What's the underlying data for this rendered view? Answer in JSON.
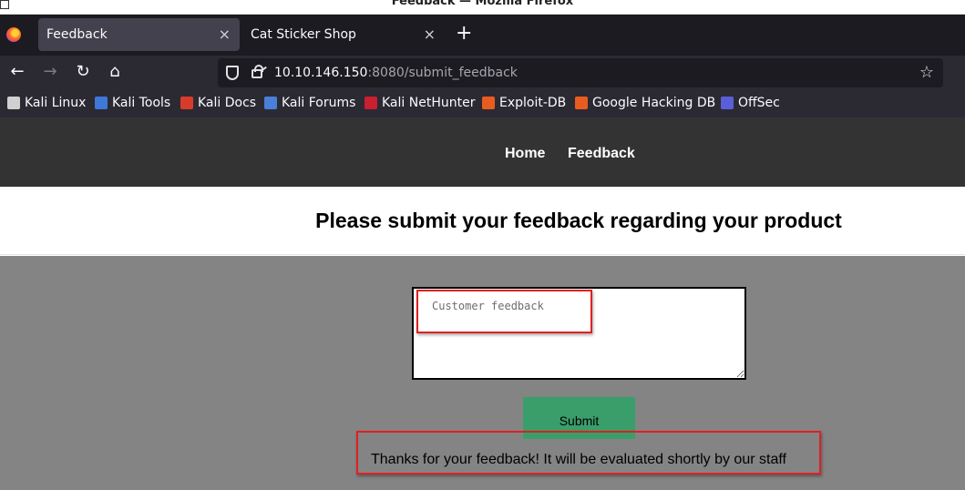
{
  "window": {
    "title": "Feedback — Mozilla Firefox"
  },
  "tabs": [
    {
      "label": "Feedback",
      "close": "×"
    },
    {
      "label": "Cat Sticker Shop",
      "close": "×"
    }
  ],
  "new_tab": "+",
  "nav": {
    "back": "←",
    "forward": "→",
    "reload": "↻",
    "home": "⌂"
  },
  "url": {
    "host": "10.10.146.150",
    "path": ":8080/submit_feedback"
  },
  "bookmark_star": "☆",
  "bookmarks": [
    {
      "label": "Kali Linux",
      "icon": "kali-dragon-icon",
      "color": "#d0d0d0"
    },
    {
      "label": "Kali Tools",
      "icon": "kali-tools-icon",
      "color": "#3f78d8"
    },
    {
      "label": "Kali Docs",
      "icon": "kali-docs-icon",
      "color": "#d93b2b"
    },
    {
      "label": "Kali Forums",
      "icon": "kali-forums-icon",
      "color": "#4a7fd9"
    },
    {
      "label": "Kali NetHunter",
      "icon": "nethunter-icon",
      "color": "#c91f2f"
    },
    {
      "label": "Exploit-DB",
      "icon": "exploit-db-icon",
      "color": "#e85d1f"
    },
    {
      "label": "Google Hacking DB",
      "icon": "ghdb-icon",
      "color": "#e85d1f"
    },
    {
      "label": "OffSec",
      "icon": "offsec-icon",
      "color": "#5a5fd9"
    }
  ],
  "site_nav": {
    "home": "Home",
    "feedback": "Feedback"
  },
  "page": {
    "heading": "Please submit your feedback regarding your product",
    "feedback_placeholder": "Customer feedback",
    "submit_label": "Submit",
    "message": "Thanks for your feedback! It will be evaluated shortly by our staff"
  },
  "colors": {
    "header_bg": "#333333",
    "form_bg": "#848484",
    "submit_bg": "#3a9e6b",
    "annotation": "#e02020"
  }
}
